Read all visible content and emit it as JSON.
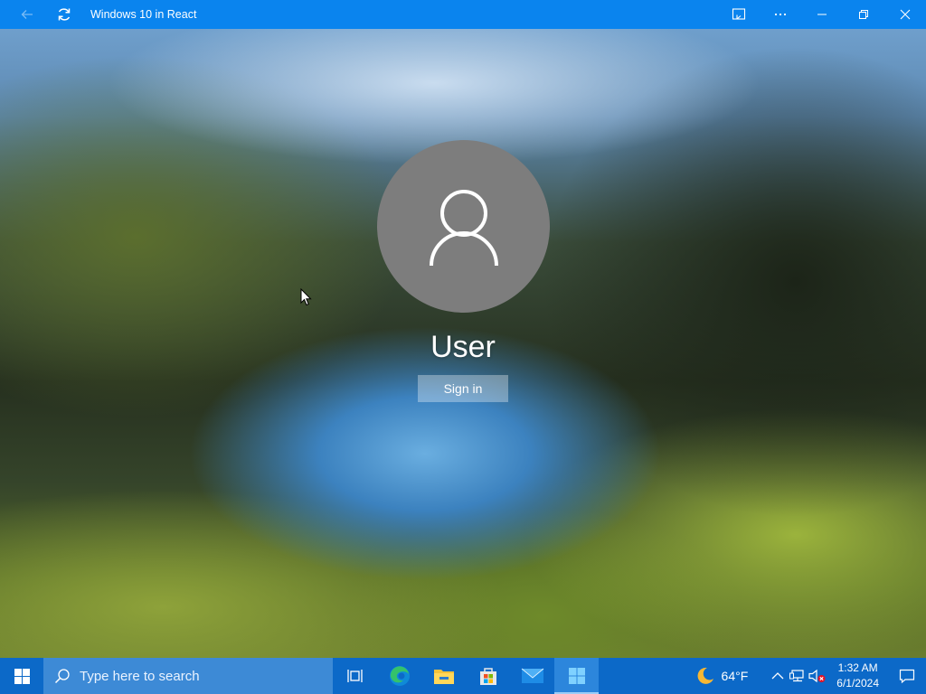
{
  "window": {
    "title": "Windows 10 in React",
    "icons": [
      "back-arrow-icon",
      "refresh-icon",
      "cast-icon",
      "more-icon",
      "minimize-icon",
      "restore-icon",
      "close-icon"
    ]
  },
  "lockscreen": {
    "user_name": "User",
    "signin_label": "Sign in",
    "avatar_icon": "user-icon"
  },
  "taskbar": {
    "search_placeholder": "Type here to search",
    "apps": [
      "task-view-icon",
      "edge-icon",
      "file-explorer-icon",
      "store-icon",
      "mail-icon",
      "windows-app-icon"
    ],
    "weather": {
      "icon": "moon-icon",
      "temperature": "64°F"
    },
    "tray_icons": [
      "chevron-up-icon",
      "network-icon",
      "volume-muted-icon"
    ],
    "clock": {
      "time": "1:32 AM",
      "date": "6/1/2024"
    },
    "notification_icon": "action-center-icon"
  },
  "colors": {
    "titlebar": "#0a84ee",
    "taskbar": "#0c69c8",
    "search": "#3d8ad6",
    "avatar": "#7d7d7d"
  }
}
